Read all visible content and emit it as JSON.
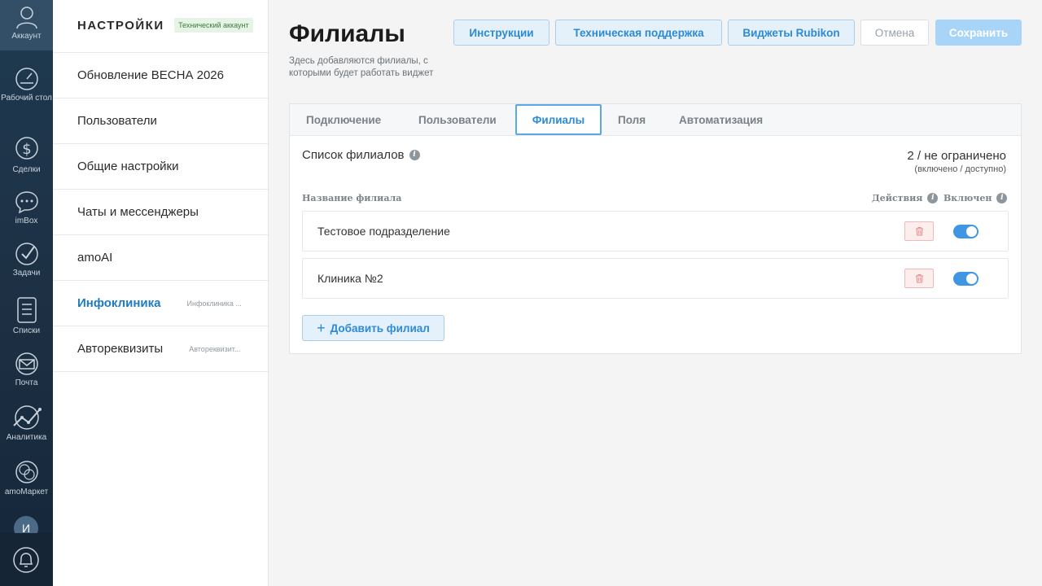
{
  "rail": {
    "items": [
      {
        "label": "Аккаунт",
        "icon": "user-icon"
      },
      {
        "label": "Рабочий стол",
        "icon": "dashboard-icon"
      },
      {
        "label": "Сделки",
        "icon": "dollar-icon"
      },
      {
        "label": "imBox",
        "icon": "chat-icon"
      },
      {
        "label": "Задачи",
        "icon": "check-icon"
      },
      {
        "label": "Списки",
        "icon": "list-icon"
      },
      {
        "label": "Почта",
        "icon": "mail-icon"
      },
      {
        "label": "Аналитика",
        "icon": "analytics-icon"
      },
      {
        "label": "amoМаркет",
        "icon": "market-icon"
      }
    ],
    "avatar_letter": "И",
    "bell_icon": "bell-icon"
  },
  "sidebar": {
    "title": "НАСТРОЙКИ",
    "badge": "Технический аккаунт",
    "items": [
      {
        "label": "Обновление ВЕСНА 2026",
        "sub": ""
      },
      {
        "label": "Пользователи",
        "sub": ""
      },
      {
        "label": "Общие настройки",
        "sub": ""
      },
      {
        "label": "Чаты и мессенджеры",
        "sub": ""
      },
      {
        "label": "amoAI",
        "sub": ""
      },
      {
        "label": "Инфоклиника",
        "sub": "Инфоклиника ..."
      },
      {
        "label": "Автореквизиты",
        "sub": "Автореквизит..."
      }
    ]
  },
  "header": {
    "title": "Филиалы",
    "description": "Здесь добавляются филиалы, с которыми будет работать виджет",
    "buttons": {
      "instructions": "Инструкции",
      "support": "Техническая поддержка",
      "widgets": "Виджеты Rubikon",
      "cancel": "Отмена",
      "save": "Сохранить"
    }
  },
  "tabs": [
    "Подключение",
    "Пользователи",
    "Филиалы",
    "Поля",
    "Автоматизация"
  ],
  "active_tab": "Филиалы",
  "branches": {
    "list_title": "Список филиалов",
    "count": "2 / не ограничено",
    "count_sub": "(включено / доступно)",
    "columns": {
      "name": "Название филиала",
      "actions": "Действия",
      "enabled": "Включен"
    },
    "rows": [
      {
        "name": "Тестовое подразделение",
        "enabled": true
      },
      {
        "name": "Клиника №2",
        "enabled": true
      }
    ],
    "add_label": "Добавить филиал"
  },
  "colors": {
    "accent": "#2d8ad3",
    "toggle_on": "#3f96e4",
    "rail_bg": "#1d3044"
  }
}
